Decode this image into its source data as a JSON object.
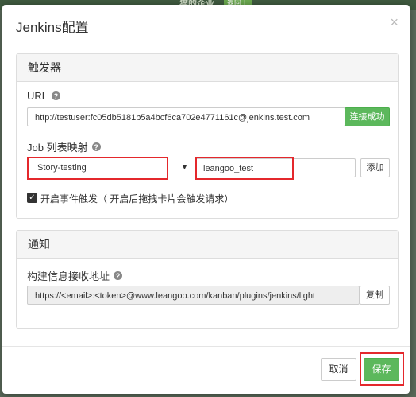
{
  "backdrop": {
    "title": "猫的企业",
    "badge": "返回上"
  },
  "modal": {
    "title": "Jenkins配置",
    "close_symbol": "×"
  },
  "trigger": {
    "heading": "触发器",
    "url_label": "URL",
    "url_value": "http://testuser:fc05db5181b5a4bcf6ca702e4771161c@jenkins.test.com",
    "connect_button": "连接成功",
    "job_label": "Job 列表映射",
    "job_select_value": "Story-testing",
    "job_input_value": "leangoo_test",
    "add_button": "添加",
    "checkbox_label": "开启事件触发（ 开启后拖拽卡片会触发请求）",
    "checkbox_checked": true
  },
  "notify": {
    "heading": "通知",
    "address_label": "构建信息接收地址",
    "address_value": "https://<email>:<token>@www.leangoo.com/kanban/plugins/jenkins/light",
    "copy_button": "复制"
  },
  "footer": {
    "cancel_button": "取消",
    "save_button": "保存"
  },
  "colors": {
    "primary_green": "#5cb85c",
    "highlight_red": "#e4282c"
  }
}
